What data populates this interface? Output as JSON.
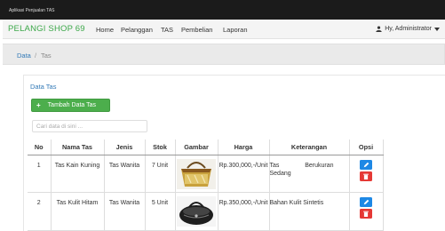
{
  "window": {
    "title": "Aplikasi Penjualan TAS"
  },
  "navbar": {
    "brand": "PELANGI SHOP 69",
    "links": [
      "Home",
      "Pelanggan",
      "TAS",
      "Pembelian",
      "Laporan"
    ],
    "user": "Hy, Administrator",
    "user_icon": "user-icon",
    "caret_icon": "caret-down-icon"
  },
  "breadcrumb": {
    "home": "Data",
    "separator": "/",
    "current": "Tas"
  },
  "panel": {
    "title": "Data Tas",
    "add_button": "Tambah Data Tas",
    "search_placeholder": "Cari data di sini ..."
  },
  "table": {
    "headers": [
      "No",
      "Nama Tas",
      "Jenis",
      "Stok",
      "Gambar",
      "Harga",
      "Keterangan",
      "Opsi"
    ],
    "rows": [
      {
        "no": "1",
        "nama": "Tas Kain Kuning",
        "jenis": "Tas Wanita",
        "stok": "7 Unit",
        "harga": "Rp.300,000,-/Unit",
        "ket_l1a": "Tas",
        "ket_l1b": "Berukuran",
        "ket_l2": "Sedang",
        "image": "yellow-bag"
      },
      {
        "no": "2",
        "nama": "Tas Kulit Hitam",
        "jenis": "Tas Wanita",
        "stok": "5 Unit",
        "harga": "Rp.350,000,-/Unit",
        "ket_l1a": "Bahan Kulit Sintetis",
        "ket_l1b": "",
        "ket_l2": "",
        "image": "black-bag"
      }
    ]
  },
  "colors": {
    "brand": "#3da84a",
    "link": "#337ab7",
    "add_button": "#4cae4c",
    "edit": "#1e88e5",
    "delete": "#e53935"
  }
}
